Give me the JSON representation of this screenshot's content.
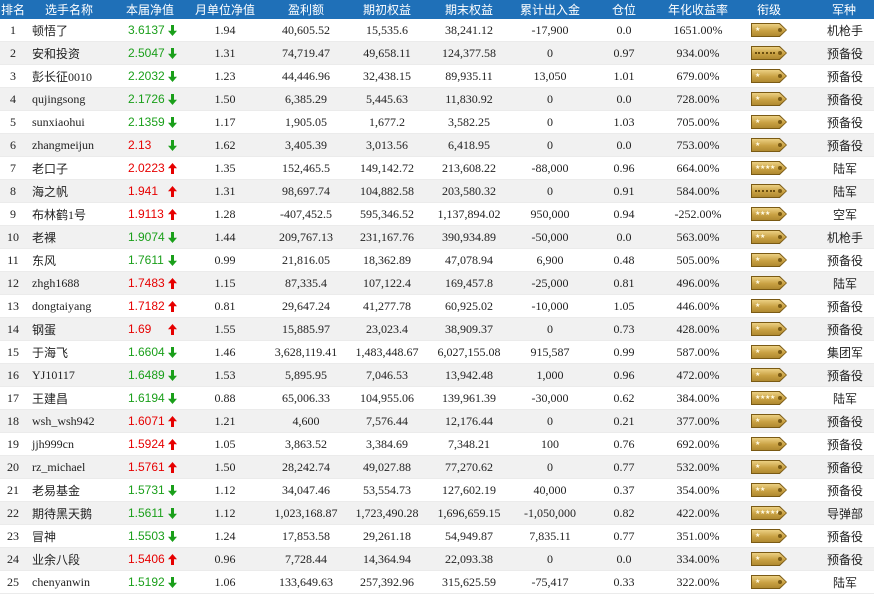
{
  "columns": [
    "排名",
    "选手名称",
    "本届净值",
    "月单位净值",
    "盈利额",
    "期初权益",
    "期末权益",
    "累计出入金",
    "仓位",
    "年化收益率",
    "衔级",
    "军种"
  ],
  "colors": {
    "header_bg": "#1f70b8",
    "green": "#1a9f1a",
    "red": "#e60000",
    "up": "#e60000",
    "down": "#1a9f1a"
  },
  "rows": [
    {
      "rank": "1",
      "name": "顿悟了",
      "nav": "3.6137",
      "nav_color": "green",
      "trend": "down",
      "month_nav": "1.94",
      "profit": "40,605.52",
      "start_equity": "15,535.6",
      "end_equity": "38,241.12",
      "net_flow": "-17,900",
      "position": "0.0",
      "annual_return": "1651.00%",
      "insignia": {
        "icon": "shoulder-board-icon",
        "stars": 1
      },
      "branch": "机枪手"
    },
    {
      "rank": "2",
      "name": "安和投资",
      "nav": "2.5047",
      "nav_color": "green",
      "trend": "down",
      "month_nav": "1.31",
      "profit": "74,719.47",
      "start_equity": "49,658.11",
      "end_equity": "124,377.58",
      "net_flow": "0",
      "position": "0.97",
      "annual_return": "934.00%",
      "insignia": {
        "icon": "shoulder-board-icon",
        "stars": 0
      },
      "branch": "预备役"
    },
    {
      "rank": "3",
      "name": "彭长征0010",
      "nav": "2.2032",
      "nav_color": "green",
      "trend": "down",
      "month_nav": "1.23",
      "profit": "44,446.96",
      "start_equity": "32,438.15",
      "end_equity": "89,935.11",
      "net_flow": "13,050",
      "position": "1.01",
      "annual_return": "679.00%",
      "insignia": {
        "icon": "shoulder-board-icon",
        "stars": 1
      },
      "branch": "预备役"
    },
    {
      "rank": "4",
      "name": "qujingsong",
      "nav": "2.1726",
      "nav_color": "green",
      "trend": "down",
      "month_nav": "1.50",
      "profit": "6,385.29",
      "start_equity": "5,445.63",
      "end_equity": "11,830.92",
      "net_flow": "0",
      "position": "0.0",
      "annual_return": "728.00%",
      "insignia": {
        "icon": "shoulder-board-icon",
        "stars": 1
      },
      "branch": "预备役"
    },
    {
      "rank": "5",
      "name": "sunxiaohui",
      "nav": "2.1359",
      "nav_color": "green",
      "trend": "down",
      "month_nav": "1.17",
      "profit": "1,905.05",
      "start_equity": "1,677.2",
      "end_equity": "3,582.25",
      "net_flow": "0",
      "position": "1.03",
      "annual_return": "705.00%",
      "insignia": {
        "icon": "shoulder-board-icon",
        "stars": 1
      },
      "branch": "预备役"
    },
    {
      "rank": "6",
      "name": "zhangmeijun",
      "nav": "2.13",
      "nav_color": "red",
      "trend": "down",
      "month_nav": "1.62",
      "profit": "3,405.39",
      "start_equity": "3,013.56",
      "end_equity": "6,418.95",
      "net_flow": "0",
      "position": "0.0",
      "annual_return": "753.00%",
      "insignia": {
        "icon": "shoulder-board-icon",
        "stars": 1
      },
      "branch": "预备役"
    },
    {
      "rank": "7",
      "name": "老口子",
      "nav": "2.0223",
      "nav_color": "red",
      "trend": "up",
      "month_nav": "1.35",
      "profit": "152,465.5",
      "start_equity": "149,142.72",
      "end_equity": "213,608.22",
      "net_flow": "-88,000",
      "position": "0.96",
      "annual_return": "664.00%",
      "insignia": {
        "icon": "shoulder-board-icon",
        "stars": 4
      },
      "branch": "陆军"
    },
    {
      "rank": "8",
      "name": "海之帆",
      "nav": "1.941",
      "nav_color": "red",
      "trend": "up",
      "month_nav": "1.31",
      "profit": "98,697.74",
      "start_equity": "104,882.58",
      "end_equity": "203,580.32",
      "net_flow": "0",
      "position": "0.91",
      "annual_return": "584.00%",
      "insignia": {
        "icon": "shoulder-board-icon",
        "stars": 0
      },
      "branch": "陆军"
    },
    {
      "rank": "9",
      "name": "布林鹤1号",
      "nav": "1.9113",
      "nav_color": "red",
      "trend": "up",
      "month_nav": "1.28",
      "profit": "-407,452.5",
      "start_equity": "595,346.52",
      "end_equity": "1,137,894.02",
      "net_flow": "950,000",
      "position": "0.94",
      "annual_return": "-252.00%",
      "insignia": {
        "icon": "shoulder-board-icon",
        "stars": 3
      },
      "branch": "空军"
    },
    {
      "rank": "10",
      "name": "老裸",
      "nav": "1.9074",
      "nav_color": "green",
      "trend": "down",
      "month_nav": "1.44",
      "profit": "209,767.13",
      "start_equity": "231,167.76",
      "end_equity": "390,934.89",
      "net_flow": "-50,000",
      "position": "0.0",
      "annual_return": "563.00%",
      "insignia": {
        "icon": "shoulder-board-icon",
        "stars": 2
      },
      "branch": "机枪手"
    },
    {
      "rank": "11",
      "name": "东风",
      "nav": "1.7611",
      "nav_color": "green",
      "trend": "down",
      "month_nav": "0.99",
      "profit": "21,816.05",
      "start_equity": "18,362.89",
      "end_equity": "47,078.94",
      "net_flow": "6,900",
      "position": "0.48",
      "annual_return": "505.00%",
      "insignia": {
        "icon": "shoulder-board-icon",
        "stars": 1
      },
      "branch": "预备役"
    },
    {
      "rank": "12",
      "name": "zhgh1688",
      "nav": "1.7483",
      "nav_color": "red",
      "trend": "up",
      "month_nav": "1.15",
      "profit": "87,335.4",
      "start_equity": "107,122.4",
      "end_equity": "169,457.8",
      "net_flow": "-25,000",
      "position": "0.81",
      "annual_return": "496.00%",
      "insignia": {
        "icon": "shoulder-board-icon",
        "stars": 1
      },
      "branch": "陆军"
    },
    {
      "rank": "13",
      "name": "dongtaiyang",
      "nav": "1.7182",
      "nav_color": "red",
      "trend": "up",
      "month_nav": "0.81",
      "profit": "29,647.24",
      "start_equity": "41,277.78",
      "end_equity": "60,925.02",
      "net_flow": "-10,000",
      "position": "1.05",
      "annual_return": "446.00%",
      "insignia": {
        "icon": "shoulder-board-icon",
        "stars": 1
      },
      "branch": "预备役"
    },
    {
      "rank": "14",
      "name": "钢蛋",
      "nav": "1.69",
      "nav_color": "red",
      "trend": "up",
      "month_nav": "1.55",
      "profit": "15,885.97",
      "start_equity": "23,023.4",
      "end_equity": "38,909.37",
      "net_flow": "0",
      "position": "0.73",
      "annual_return": "428.00%",
      "insignia": {
        "icon": "shoulder-board-icon",
        "stars": 1
      },
      "branch": "预备役"
    },
    {
      "rank": "15",
      "name": "于海飞",
      "nav": "1.6604",
      "nav_color": "green",
      "trend": "down",
      "month_nav": "1.46",
      "profit": "3,628,119.41",
      "start_equity": "1,483,448.67",
      "end_equity": "6,027,155.08",
      "net_flow": "915,587",
      "position": "0.99",
      "annual_return": "587.00%",
      "insignia": {
        "icon": "shoulder-board-icon",
        "stars": 1
      },
      "branch": "集团军"
    },
    {
      "rank": "16",
      "name": "YJ10117",
      "nav": "1.6489",
      "nav_color": "green",
      "trend": "down",
      "month_nav": "1.53",
      "profit": "5,895.95",
      "start_equity": "7,046.53",
      "end_equity": "13,942.48",
      "net_flow": "1,000",
      "position": "0.96",
      "annual_return": "472.00%",
      "insignia": {
        "icon": "shoulder-board-icon",
        "stars": 1
      },
      "branch": "预备役"
    },
    {
      "rank": "17",
      "name": "王建昌",
      "nav": "1.6194",
      "nav_color": "green",
      "trend": "down",
      "month_nav": "0.88",
      "profit": "65,006.33",
      "start_equity": "104,955.06",
      "end_equity": "139,961.39",
      "net_flow": "-30,000",
      "position": "0.62",
      "annual_return": "384.00%",
      "insignia": {
        "icon": "shoulder-board-icon",
        "stars": 4
      },
      "branch": "陆军"
    },
    {
      "rank": "18",
      "name": "wsh_wsh942",
      "nav": "1.6071",
      "nav_color": "red",
      "trend": "up",
      "month_nav": "1.21",
      "profit": "4,600",
      "start_equity": "7,576.44",
      "end_equity": "12,176.44",
      "net_flow": "0",
      "position": "0.21",
      "annual_return": "377.00%",
      "insignia": {
        "icon": "shoulder-board-icon",
        "stars": 1
      },
      "branch": "预备役"
    },
    {
      "rank": "19",
      "name": "jjh999cn",
      "nav": "1.5924",
      "nav_color": "red",
      "trend": "up",
      "month_nav": "1.05",
      "profit": "3,863.52",
      "start_equity": "3,384.69",
      "end_equity": "7,348.21",
      "net_flow": "100",
      "position": "0.76",
      "annual_return": "692.00%",
      "insignia": {
        "icon": "shoulder-board-icon",
        "stars": 1
      },
      "branch": "预备役"
    },
    {
      "rank": "20",
      "name": "rz_michael",
      "nav": "1.5761",
      "nav_color": "red",
      "trend": "up",
      "month_nav": "1.50",
      "profit": "28,242.74",
      "start_equity": "49,027.88",
      "end_equity": "77,270.62",
      "net_flow": "0",
      "position": "0.77",
      "annual_return": "532.00%",
      "insignia": {
        "icon": "shoulder-board-icon",
        "stars": 1
      },
      "branch": "预备役"
    },
    {
      "rank": "21",
      "name": "老易基金",
      "nav": "1.5731",
      "nav_color": "green",
      "trend": "down",
      "month_nav": "1.12",
      "profit": "34,047.46",
      "start_equity": "53,554.73",
      "end_equity": "127,602.19",
      "net_flow": "40,000",
      "position": "0.37",
      "annual_return": "354.00%",
      "insignia": {
        "icon": "shoulder-board-icon",
        "stars": 2
      },
      "branch": "预备役"
    },
    {
      "rank": "22",
      "name": "期待黑天鹅",
      "nav": "1.5611",
      "nav_color": "green",
      "trend": "down",
      "month_nav": "1.12",
      "profit": "1,023,168.87",
      "start_equity": "1,723,490.28",
      "end_equity": "1,696,659.15",
      "net_flow": "-1,050,000",
      "position": "0.82",
      "annual_return": "422.00%",
      "insignia": {
        "icon": "shoulder-board-icon",
        "stars": 5
      },
      "branch": "导弹部"
    },
    {
      "rank": "23",
      "name": "冒神",
      "nav": "1.5503",
      "nav_color": "green",
      "trend": "down",
      "month_nav": "1.24",
      "profit": "17,853.58",
      "start_equity": "29,261.18",
      "end_equity": "54,949.87",
      "net_flow": "7,835.11",
      "position": "0.77",
      "annual_return": "351.00%",
      "insignia": {
        "icon": "shoulder-board-icon",
        "stars": 1
      },
      "branch": "预备役"
    },
    {
      "rank": "24",
      "name": "业余八段",
      "nav": "1.5406",
      "nav_color": "red",
      "trend": "up",
      "month_nav": "0.96",
      "profit": "7,728.44",
      "start_equity": "14,364.94",
      "end_equity": "22,093.38",
      "net_flow": "0",
      "position": "0.0",
      "annual_return": "334.00%",
      "insignia": {
        "icon": "shoulder-board-icon",
        "stars": 1
      },
      "branch": "预备役"
    },
    {
      "rank": "25",
      "name": "chenyanwin",
      "nav": "1.5192",
      "nav_color": "green",
      "trend": "down",
      "month_nav": "1.06",
      "profit": "133,649.63",
      "start_equity": "257,392.96",
      "end_equity": "315,625.59",
      "net_flow": "-75,417",
      "position": "0.33",
      "annual_return": "322.00%",
      "insignia": {
        "icon": "shoulder-board-icon",
        "stars": 1
      },
      "branch": "陆军"
    }
  ]
}
